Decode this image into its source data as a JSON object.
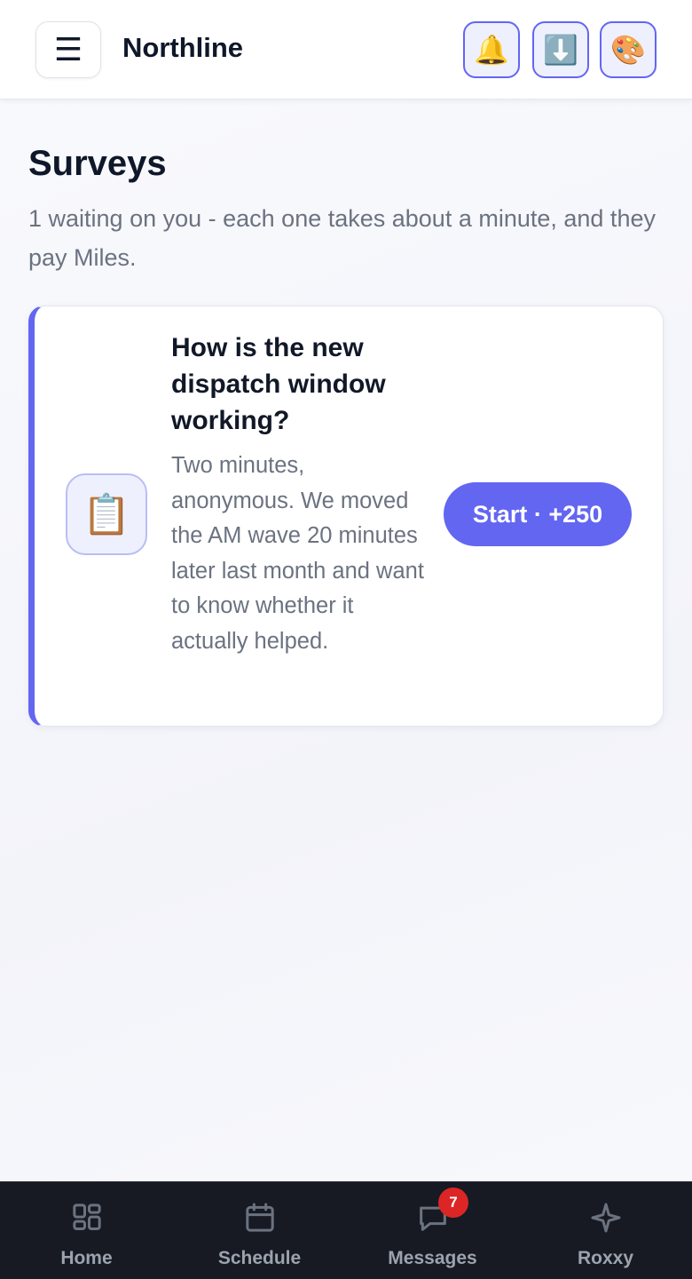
{
  "header": {
    "menu_glyph": "☰",
    "brand": "Northline",
    "actions": [
      {
        "name": "notifications",
        "glyph": "🔔"
      },
      {
        "name": "download",
        "glyph": "⬇️"
      },
      {
        "name": "theme",
        "glyph": "🎨"
      }
    ]
  },
  "page": {
    "title": "Surveys",
    "subtitle": "1 waiting on you - each one takes about a minute, and they pay Miles."
  },
  "surveys": [
    {
      "icon": "📋",
      "title": "How is the new dispatch window working?",
      "description": "Two minutes, anonymous. We moved the AM wave 20 minutes later last month and want to know whether it actually helped.",
      "cta": "Start · +250"
    }
  ],
  "bottom_nav": {
    "items": [
      {
        "label": "Home",
        "icon": "home-grid-icon"
      },
      {
        "label": "Schedule",
        "icon": "calendar-icon"
      },
      {
        "label": "Messages",
        "icon": "message-icon",
        "badge": "7"
      },
      {
        "label": "Roxxy",
        "icon": "sparkle-icon"
      }
    ]
  },
  "colors": {
    "accent": "#6366f1",
    "badge": "#dc2626",
    "nav_bg": "#171a22"
  }
}
